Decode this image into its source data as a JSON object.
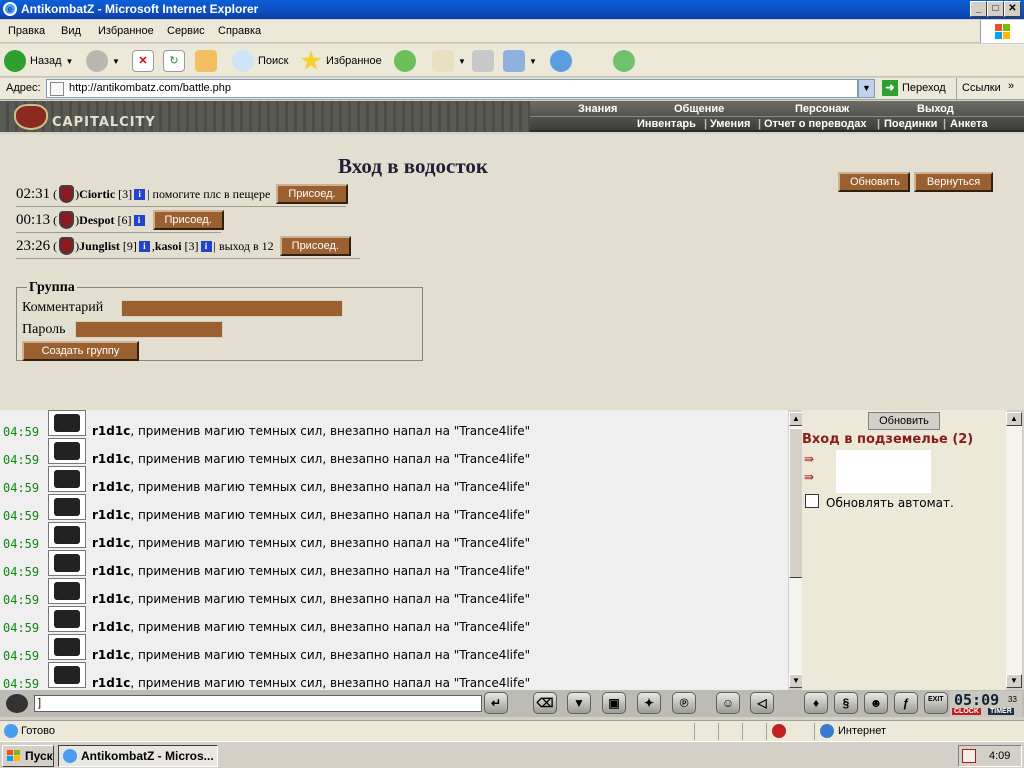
{
  "window": {
    "title": "AntikombatZ - Microsoft Internet Explorer"
  },
  "menu": [
    "Правка",
    "Вид",
    "Избранное",
    "Сервис",
    "Справка"
  ],
  "toolbar": {
    "back": "Назад",
    "search": "Поиск",
    "favorites": "Избранное"
  },
  "address": {
    "label": "Адрес:",
    "url": "http://antikombatz.com/battle.php",
    "go": "Переход",
    "links": "Ссылки"
  },
  "game_header": {
    "logo_text": "CAPITALCITY",
    "top_nav": [
      "Знания",
      "Общение",
      "Персонаж",
      "Выход"
    ],
    "sub_nav": [
      "Инвентарь",
      "Умения",
      "Отчет о переводах",
      "Поединки",
      "Анкета"
    ]
  },
  "page": {
    "title": "Вход в водосток",
    "refresh": "Обновить",
    "back": "Вернуться",
    "groups": [
      {
        "time": "02:31",
        "players": [
          {
            "name": "Ciortic",
            "level": "[3]"
          }
        ],
        "comment": "| помогите плс в пещере",
        "join": "Присоед."
      },
      {
        "time": "00:13",
        "players": [
          {
            "name": "Despot",
            "level": "[6]"
          }
        ],
        "comment": "",
        "join": "Присоед."
      },
      {
        "time": "23:26",
        "players": [
          {
            "name": "Junglist",
            "level": "[9]"
          },
          {
            "name": "kasoi",
            "level": "[3]"
          }
        ],
        "comment": "| выход в 12",
        "join": "Присоед."
      }
    ],
    "group_form": {
      "legend": "Группа",
      "comment_label": "Комментарий",
      "password_label": "Пароль",
      "create": "Создать группу"
    }
  },
  "chat": {
    "lines": [
      {
        "time": "04:59",
        "name": "r1d1c",
        "text": ", применив магию темных сил, внезапно напал на \"Trance4life\""
      },
      {
        "time": "04:59",
        "name": "r1d1c",
        "text": ", применив магию темных сил, внезапно напал на \"Trance4life\""
      },
      {
        "time": "04:59",
        "name": "r1d1c",
        "text": ", применив магию темных сил, внезапно напал на \"Trance4life\""
      },
      {
        "time": "04:59",
        "name": "r1d1c",
        "text": ", применив магию темных сил, внезапно напал на \"Trance4life\""
      },
      {
        "time": "04:59",
        "name": "r1d1c",
        "text": ", применив магию темных сил, внезапно напал на \"Trance4life\""
      },
      {
        "time": "04:59",
        "name": "r1d1c",
        "text": ", применив магию темных сил, внезапно напал на \"Trance4life\""
      },
      {
        "time": "04:59",
        "name": "r1d1c",
        "text": ", применив магию темных сил, внезапно напал на \"Trance4life\""
      },
      {
        "time": "04:59",
        "name": "r1d1c",
        "text": ", применив магию темных сил, внезапно напал на \"Trance4life\""
      },
      {
        "time": "04:59",
        "name": "r1d1c",
        "text": ", применив магию темных сил, внезапно напал на \"Trance4life\""
      },
      {
        "time": "04:59",
        "name": "r1d1c",
        "text": ", применив магию темных сил, внезапно напал на \"Trance4life\""
      }
    ],
    "input_value": "]"
  },
  "right_panel": {
    "refresh": "Обновить",
    "heading": "Вход в подземелье (2)",
    "auto_refresh_label": "Обновлять автомат."
  },
  "game_clock": {
    "time": "05:09",
    "seconds": "33",
    "clock_label": "CLOCK",
    "timer_label": "TIMER",
    "exit_label": "EXIT"
  },
  "status": {
    "text": "Готово",
    "zone": "Интернет"
  },
  "taskbar": {
    "start": "Пуск",
    "item": "AntikombatZ - Micros...",
    "time": "4:09"
  },
  "colors": {
    "chat_time": "#128612",
    "heading_red": "#8b1a1a",
    "button_brown": "#9a6030"
  }
}
